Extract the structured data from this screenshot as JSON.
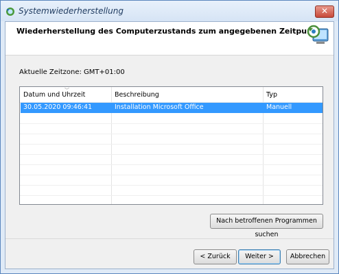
{
  "window": {
    "title": "Systemwiederherstellung",
    "close_label": "✕"
  },
  "header": {
    "title": "Wiederherstellung des Computerzustands zum angegebenen Zeitpunkt"
  },
  "timezone_text": "Aktuelle Zeitzone: GMT+01:00",
  "table": {
    "columns": [
      "Datum und Uhrzeit",
      "Beschreibung",
      "Typ"
    ],
    "rows": [
      {
        "date": "30.05.2020 09:46:41",
        "description": "Installation Microsoft Office",
        "type": "Manuell",
        "selected": true
      }
    ]
  },
  "buttons": {
    "scan": "Nach betroffenen Programmen suchen",
    "back": "< Zurück",
    "next": "Weiter >",
    "cancel": "Abbrechen"
  },
  "colors": {
    "selection": "#3399ff",
    "frame": "#dfeaf7"
  },
  "icons": {
    "app": "system-restore-icon",
    "header": "system-restore-computer-icon",
    "sort": "sort-indicator-icon"
  }
}
